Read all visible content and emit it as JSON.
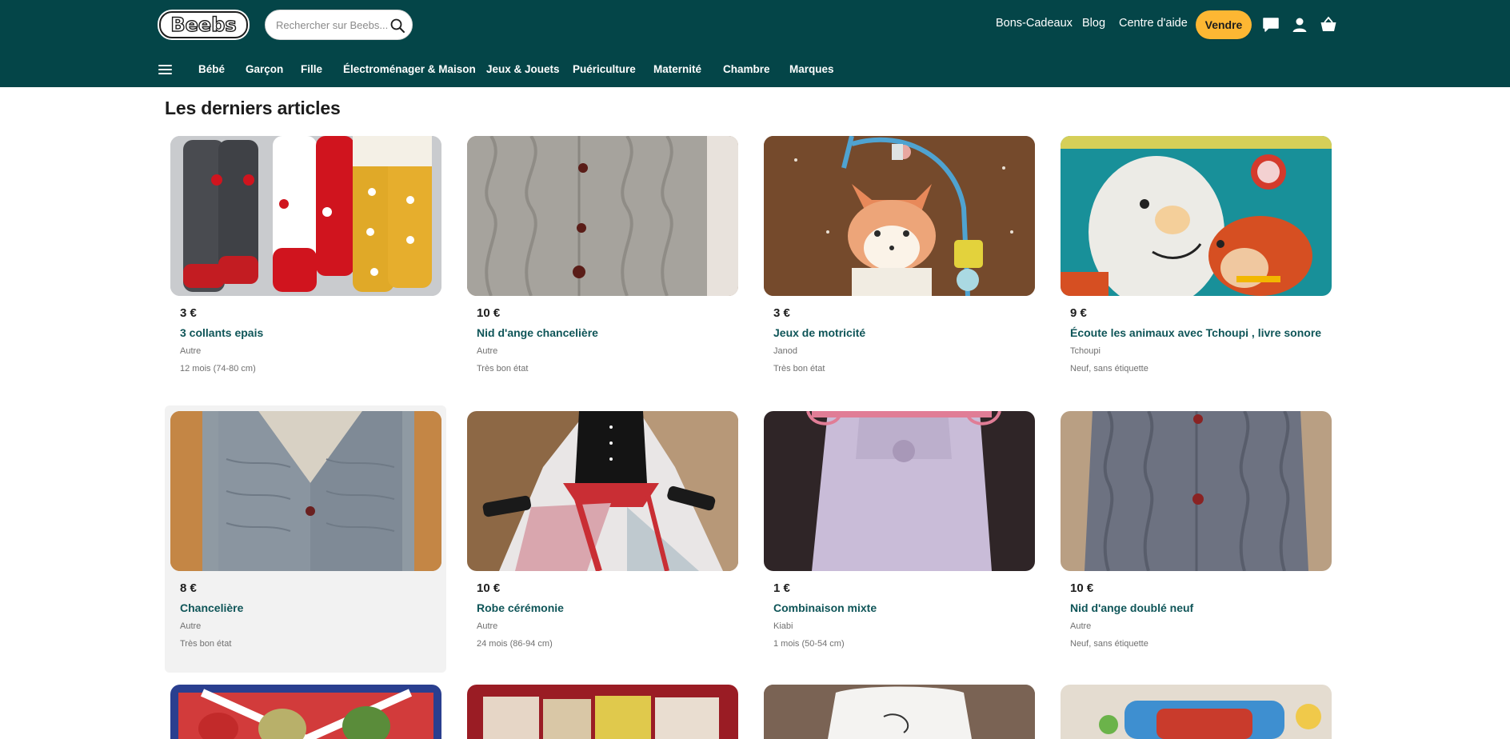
{
  "header": {
    "logo_text": "Beebs",
    "search_placeholder": "Rechercher sur Beebs...",
    "links": [
      "Bons-Cadeaux",
      "Blog",
      "Centre d'aide"
    ],
    "sell_label": "Vendre",
    "icons": [
      "search-icon",
      "chat-icon",
      "user-icon",
      "basket-icon",
      "menu-icon"
    ],
    "categories": [
      "Bébé",
      "Garçon",
      "Fille",
      "Électroménager & Maison",
      "Jeux & Jouets",
      "Puériculture",
      "Maternité",
      "Chambre",
      "Marques"
    ],
    "colors": {
      "header_bg": "#044548",
      "accent": "#fdb733",
      "title_link": "#0f5558"
    }
  },
  "main": {
    "section_title": "Les derniers articles",
    "products": [
      {
        "price": "3 €",
        "title": "3 collants epais",
        "brand": "Autre",
        "condition": "12 mois (74-80 cm)"
      },
      {
        "price": "10 €",
        "title": "Nid d'ange chancelière",
        "brand": "Autre",
        "condition": "Très bon état"
      },
      {
        "price": "3 €",
        "title": "Jeux de motricité",
        "brand": "Janod",
        "condition": "Très bon état"
      },
      {
        "price": "9 €",
        "title": "Écoute les animaux avec Tchoupi , livre sonore",
        "brand": "Tchoupi",
        "condition": "Neuf, sans étiquette"
      },
      {
        "price": "8 €",
        "title": "Chancelière",
        "brand": "Autre",
        "condition": "Très bon état"
      },
      {
        "price": "10 €",
        "title": "Robe cérémonie",
        "brand": "Autre",
        "condition": "24 mois (86-94 cm)"
      },
      {
        "price": "1 €",
        "title": "Combinaison mixte",
        "brand": "Kiabi",
        "condition": "1 mois (50-54 cm)"
      },
      {
        "price": "10 €",
        "title": "Nid d'ange doublé neuf",
        "brand": "Autre",
        "condition": "Neuf, sans étiquette"
      }
    ]
  }
}
